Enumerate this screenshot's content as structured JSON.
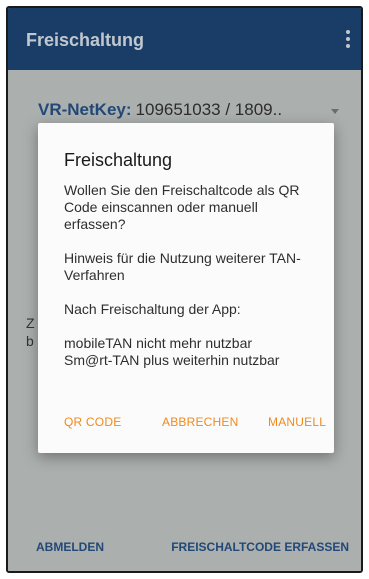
{
  "appbar": {
    "title": "Freischaltung"
  },
  "netkey": {
    "label": "VR-NetKey:",
    "value": "109651033 / 1809.."
  },
  "background_peek": {
    "text": "Z\nb"
  },
  "bottom_bar": {
    "left_label": "ABMELDEN",
    "right_label": "FREISCHALTCODE ERFASSEN"
  },
  "dialog": {
    "title": "Freischaltung",
    "paragraph1": "Wollen Sie den Freischaltcode als QR Code einscannen oder manuell erfassen?",
    "paragraph2": "Hinweis für die Nutzung weiterer TAN-Verfahren",
    "paragraph3": "Nach Freischaltung der App:",
    "line4a": "mobileTAN nicht mehr nutzbar",
    "line4b": "Sm@rt-TAN plus weiterhin nutzbar",
    "actions": {
      "qr": "QR CODE",
      "cancel": "ABBRECHEN",
      "manual": "MANUELL"
    }
  },
  "colors": {
    "appbar": "#123e70",
    "accent": "#f08a1c",
    "link": "#1d4b84"
  }
}
